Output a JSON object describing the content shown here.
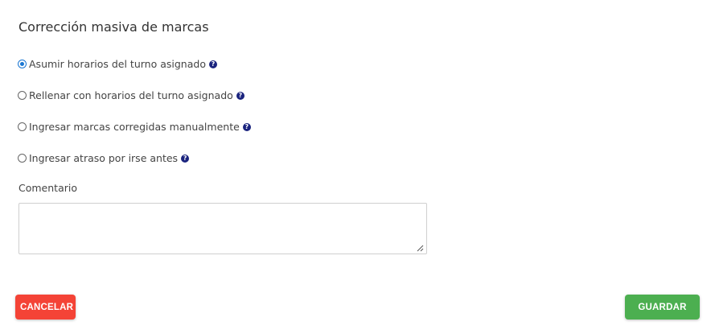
{
  "title": "Corrección masiva de marcas",
  "options": [
    {
      "label": "Asumir horarios del turno asignado",
      "checked": true
    },
    {
      "label": "Rellenar con horarios del turno asignado",
      "checked": false
    },
    {
      "label": "Ingresar marcas corregidas manualmente",
      "checked": false
    },
    {
      "label": "Ingresar atraso por irse antes",
      "checked": false
    }
  ],
  "help_icon_glyph": "?",
  "comment": {
    "label": "Comentario",
    "value": ""
  },
  "buttons": {
    "cancel_label": "CANCELAR",
    "save_label": "GUARDAR"
  },
  "colors": {
    "cancel": "#f44336",
    "save": "#4caf50",
    "help_icon": "#1a237e",
    "radio_checked": "#1976d2"
  }
}
